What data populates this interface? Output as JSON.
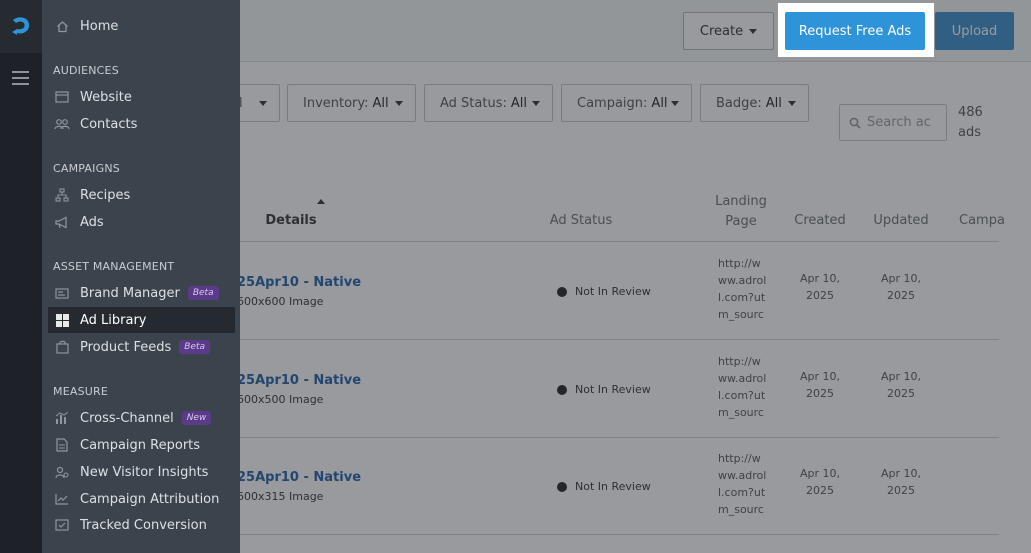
{
  "header": {
    "create_label": "Create",
    "request_label": "Request Free Ads",
    "upload_label": "Upload"
  },
  "filters": [
    {
      "prefix": "",
      "value": "l"
    },
    {
      "prefix": "Inventory:",
      "value": "All"
    },
    {
      "prefix": "Ad Status:",
      "value": "All"
    },
    {
      "prefix": "Campaign:",
      "value": "All"
    },
    {
      "prefix": "Badge:",
      "value": "All"
    }
  ],
  "search": {
    "placeholder": "Search ac"
  },
  "ad_count": {
    "number": "486",
    "unit": "ads"
  },
  "table": {
    "columns": {
      "details": "Details",
      "status": "Ad Status",
      "landing": "Landing Page",
      "created": "Created",
      "updated": "Updated",
      "campaign": "Campa"
    },
    "rows": [
      {
        "name": "25Apr10 - Native",
        "sub": "600x600 Image",
        "status": "Not In Review",
        "landing": "http://www.adroll.com?utm_sourc",
        "created": "Apr 10, 2025",
        "updated": "Apr 10, 2025"
      },
      {
        "name": "25Apr10 - Native",
        "sub": "600x500 Image",
        "status": "Not In Review",
        "landing": "http://www.adroll.com?utm_sourc",
        "created": "Apr 10, 2025",
        "updated": "Apr 10, 2025"
      },
      {
        "name": "25Apr10 - Native",
        "sub": "600x315 Image",
        "status": "Not In Review",
        "landing": "http://www.adroll.com?utm_sourc",
        "created": "Apr 10, 2025",
        "updated": "Apr 10, 2025"
      }
    ]
  },
  "nav": {
    "home": "Home",
    "audiences": "AUDIENCES",
    "website": "Website",
    "contacts": "Contacts",
    "campaigns": "CAMPAIGNS",
    "recipes": "Recipes",
    "ads": "Ads",
    "asset_management": "ASSET MANAGEMENT",
    "brand_manager": "Brand Manager",
    "brand_manager_badge": "Beta",
    "ad_library": "Ad Library",
    "product_feeds": "Product Feeds",
    "product_feeds_badge": "Beta",
    "measure": "MEASURE",
    "cross_channel": "Cross-Channel",
    "cross_channel_badge": "New",
    "campaign_reports": "Campaign Reports",
    "new_visitor_insights": "New Visitor Insights",
    "campaign_attribution": "Campaign Attribution",
    "tracked_conversion": "Tracked Conversion"
  },
  "colors": {
    "drawer_bg": "#3b434c",
    "rail_bg": "#1e2228",
    "accent_blue": "#2f93d9",
    "link_blue": "#1f5fa8",
    "badge_purple": "#5b3a8a"
  }
}
